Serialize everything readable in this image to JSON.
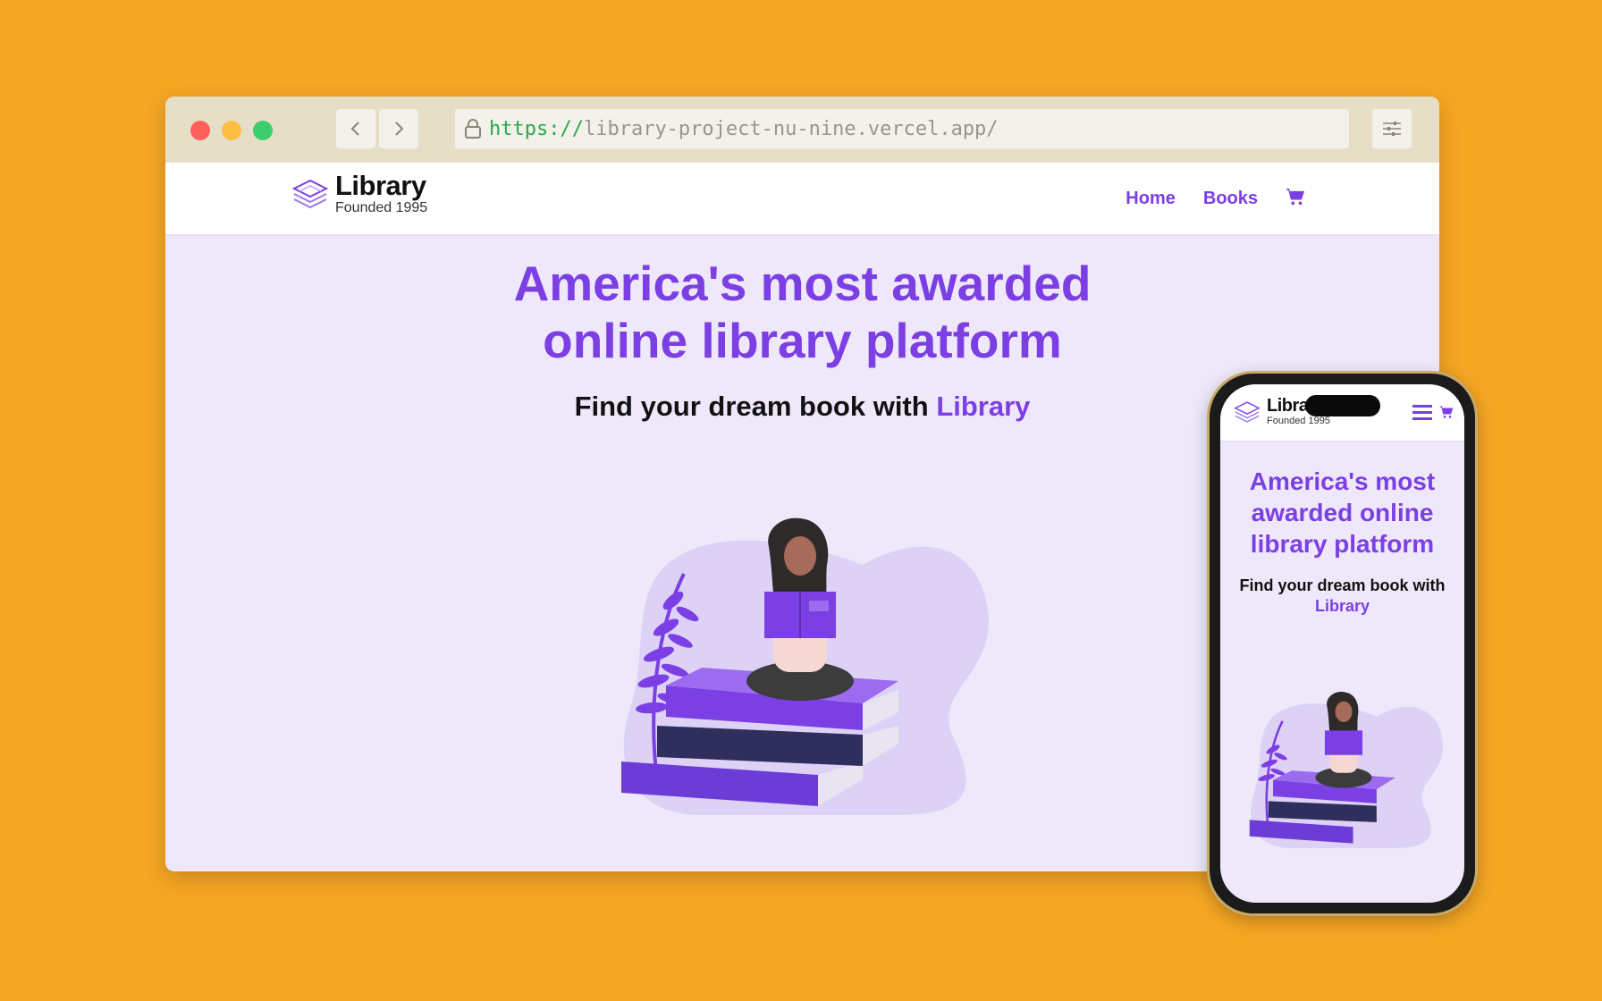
{
  "browser": {
    "url_scheme": "https://",
    "url_host": "library-project-nu-nine.vercel.app/"
  },
  "site": {
    "logo_title": "Library",
    "logo_subtitle": "Founded 1995",
    "nav": [
      {
        "label": "Home"
      },
      {
        "label": "Books"
      }
    ],
    "hero_title": "America's most awarded online library platform",
    "hero_subtitle_prefix": "Find your dream book with ",
    "hero_subtitle_accent": "Library"
  },
  "mobile": {
    "logo_title": "Library",
    "logo_subtitle": "Founded 1995",
    "hero_title": "America's most awarded online library platform",
    "hero_subtitle_prefix": "Find your dream book with",
    "hero_subtitle_accent": "Library"
  },
  "icons": {
    "cart": "cart-icon",
    "menu": "hamburger-menu-icon",
    "lock": "lock-icon",
    "logo": "books-stack-logo-icon",
    "settings": "sliders-icon"
  },
  "colors": {
    "background": "#F5A623",
    "accent": "#7B3FE4",
    "hero_bg": "#EFE8FA",
    "browser_chrome": "#E7DEC8"
  }
}
